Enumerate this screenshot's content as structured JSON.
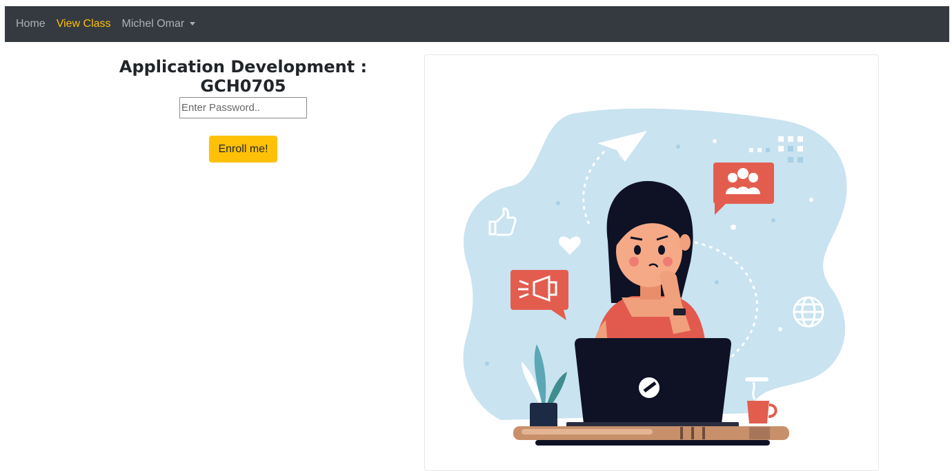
{
  "navbar": {
    "items": [
      {
        "label": "Home",
        "active": false
      },
      {
        "label": "View Class",
        "active": true
      },
      {
        "label": "Michel Omar",
        "active": false,
        "dropdown": true
      }
    ],
    "background": "#343a40",
    "active_color": "#ffc107"
  },
  "main": {
    "title": "Application Development : GCH0705",
    "password_placeholder": "Enter Password..",
    "password_value": "",
    "enroll_label": "Enroll me!",
    "enroll_color": "#ffc107"
  },
  "illustration": {
    "description_icons": [
      "paper-plane-icon",
      "users-icon",
      "thumbs-up-icon",
      "heart-icon",
      "megaphone-icon",
      "globe-icon",
      "laptop-icon",
      "plant-icon",
      "coffee-cup-icon"
    ],
    "colors": {
      "blob": "#c9e3f0",
      "accent": "#e35d4f",
      "laptop": "#1d1f2e",
      "desk": "#c8906a"
    }
  }
}
